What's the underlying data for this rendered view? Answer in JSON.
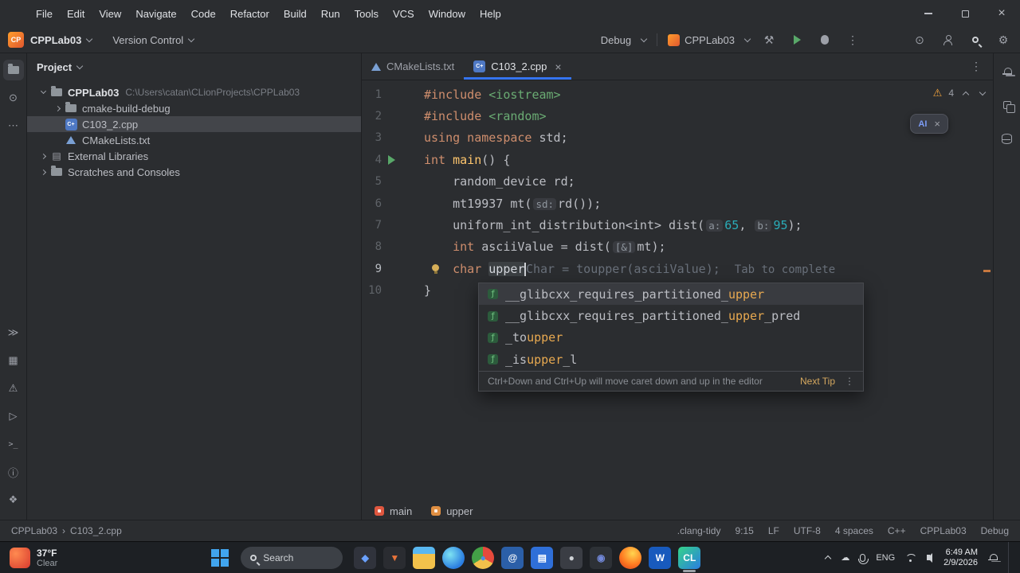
{
  "menu": {
    "items": [
      "File",
      "Edit",
      "View",
      "Navigate",
      "Code",
      "Refactor",
      "Build",
      "Run",
      "Tools",
      "VCS",
      "Window",
      "Help"
    ]
  },
  "toolbar": {
    "logo": "CP",
    "project": "CPPLab03",
    "vcs": "Version Control",
    "config": "Debug",
    "target": "CPPLab03"
  },
  "project_panel": {
    "title": "Project",
    "tree": [
      {
        "label": "CPPLab03",
        "path": "C:\\Users\\catan\\CLionProjects\\CPPLab03",
        "level": 0,
        "chevron": "down",
        "icon": "folder",
        "bold": true
      },
      {
        "label": "cmake-build-debug",
        "level": 1,
        "chevron": "right",
        "icon": "folder"
      },
      {
        "label": "C103_2.cpp",
        "level": 1,
        "chevron": "none",
        "icon": "cpp",
        "selected": true
      },
      {
        "label": "CMakeLists.txt",
        "level": 1,
        "chevron": "none",
        "icon": "cmake"
      },
      {
        "label": "External Libraries",
        "level": 0,
        "chevron": "right",
        "icon": "lib"
      },
      {
        "label": "Scratches and Consoles",
        "level": 0,
        "chevron": "right",
        "icon": "folder"
      }
    ]
  },
  "editor": {
    "tabs": [
      {
        "label": "CMakeLists.txt",
        "active": false
      },
      {
        "label": "C103_2.cpp",
        "active": true
      }
    ],
    "inspections": {
      "warnings": "4"
    },
    "code": [
      {
        "num": "1",
        "tokens": [
          [
            "kw",
            "#include "
          ],
          [
            "str",
            "<iostream>"
          ]
        ]
      },
      {
        "num": "2",
        "tokens": [
          [
            "kw",
            "#include "
          ],
          [
            "str",
            "<random>"
          ]
        ]
      },
      {
        "num": "3",
        "tokens": [
          [
            "kw",
            "using namespace "
          ],
          [
            "pl",
            "std;"
          ]
        ]
      },
      {
        "num": "4",
        "run": true,
        "tokens": [
          [
            "kw",
            "int "
          ],
          [
            "fn",
            "main"
          ],
          [
            "pl",
            "() {"
          ]
        ]
      },
      {
        "num": "5",
        "tokens": [
          [
            "pl",
            "    random_device rd;"
          ]
        ]
      },
      {
        "num": "6",
        "tokens": [
          [
            "pl",
            "    mt19937 mt("
          ],
          [
            "hint",
            "sd:"
          ],
          [
            "pl",
            "rd());"
          ]
        ]
      },
      {
        "num": "7",
        "tokens": [
          [
            "pl",
            "    uniform_int_distribution<int> dist("
          ],
          [
            "hint",
            "a:"
          ],
          [
            "num",
            "65"
          ],
          [
            "pl",
            ", "
          ],
          [
            "hint",
            "b:"
          ],
          [
            "num",
            "95"
          ],
          [
            "pl",
            ");"
          ]
        ]
      },
      {
        "num": "8",
        "tokens": [
          [
            "kw",
            "    int "
          ],
          [
            "pl",
            "asciiValue = dist("
          ],
          [
            "hint",
            "[&]"
          ],
          [
            "pl",
            "mt);"
          ]
        ]
      },
      {
        "num": "9",
        "bulb": true,
        "active": true,
        "tokens": [
          [
            "kw",
            "    char "
          ],
          [
            "typed",
            "upper"
          ],
          [
            "caret",
            ""
          ],
          [
            "ghost",
            "Char = toupper(asciiValue);"
          ],
          [
            "hint2",
            "Tab to complete"
          ]
        ]
      },
      {
        "num": "10",
        "tokens": [
          [
            "pl",
            "}"
          ]
        ]
      }
    ],
    "completion": {
      "items": [
        {
          "pre": "__glibcxx_requires_partitioned_",
          "match": "upper",
          "post": "",
          "selected": true
        },
        {
          "pre": "__glibcxx_requires_partitioned_",
          "match": "upper",
          "post": "_pred"
        },
        {
          "pre": "_to",
          "match": "upper",
          "post": ""
        },
        {
          "pre": "_is",
          "match": "upper",
          "post": "_l"
        }
      ],
      "footer_hint": "Ctrl+Down and Ctrl+Up will move caret down and up in the editor",
      "footer_link": "Next Tip"
    },
    "breadcrumbs": [
      {
        "label": "main",
        "color": "#e0573f"
      },
      {
        "label": "upper",
        "color": "#e08f42"
      }
    ]
  },
  "status_bar": {
    "path": [
      "CPPLab03",
      "C103_2.cpp"
    ],
    "right": [
      ".clang-tidy",
      "9:15",
      "LF",
      "UTF-8",
      "4 spaces",
      "C++",
      "CPPLab03",
      "Debug"
    ]
  },
  "taskbar": {
    "weather": {
      "temp": "37°F",
      "desc": "Clear"
    },
    "search": "Search",
    "apps": [
      {
        "name": "photos-app-icon",
        "bg": "#30333c",
        "fg": "#6aa1ff",
        "glyph": "◆"
      },
      {
        "name": "pizza-app-icon",
        "bg": "#2a2c31",
        "fg": "#e8733a",
        "glyph": "▼"
      },
      {
        "name": "file-explorer-icon",
        "bg": "linear-gradient(180deg,#59b7f0 32%,#f2c14b 32%)",
        "fg": "#ffffff",
        "glyph": ""
      },
      {
        "name": "edge-icon",
        "bg": "radial-gradient(circle at 35% 35%,#7ee3f2,#2a7de1 70%)",
        "fg": "#ffffff",
        "glyph": "",
        "round": true
      },
      {
        "name": "chrome-icon",
        "bg": "conic-gradient(#e64a3c 0 33%,#f2c14b 33% 66%,#43a047 66% 100%)",
        "fg": "#4a90e2",
        "glyph": "●",
        "round": true
      },
      {
        "name": "mail-app-icon",
        "bg": "#2b5fa8",
        "fg": "#ffffff",
        "glyph": "@"
      },
      {
        "name": "store-icon",
        "bg": "#2f6fd8",
        "fg": "#ffffff",
        "glyph": "▤"
      },
      {
        "name": "camera-app-icon",
        "bg": "#3a3d44",
        "fg": "#cfd2d6",
        "glyph": "●"
      },
      {
        "name": "discord-app-icon",
        "bg": "#2d3136",
        "fg": "#7289da",
        "glyph": "◉"
      },
      {
        "name": "firefox-icon",
        "bg": "radial-gradient(circle at 60% 30%,#ffd54f,#ff7a21 55%,#d63a1e)",
        "fg": "#ffffff",
        "glyph": "",
        "round": true
      },
      {
        "name": "word-icon",
        "bg": "#185abd",
        "fg": "#ffffff",
        "glyph": "W"
      },
      {
        "name": "clion-icon",
        "bg": "linear-gradient(135deg,#35d48a,#2a7de1)",
        "fg": "#ffffff",
        "glyph": "CL",
        "active": true
      }
    ],
    "tray": {
      "lang": "ENG",
      "time": "6:49 AM",
      "date": "2/9/2026"
    }
  }
}
